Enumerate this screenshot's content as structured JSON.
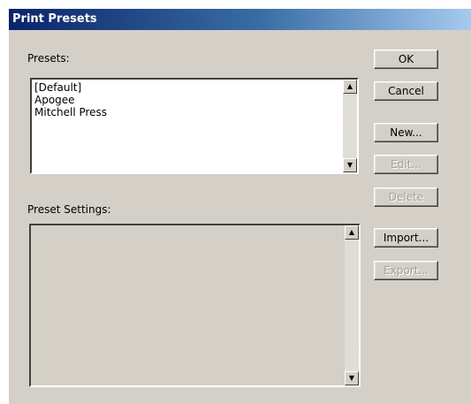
{
  "window": {
    "title": "Print Presets"
  },
  "presets": {
    "label": "Presets:",
    "items": [
      "[Default]",
      "Apogee",
      "Mitchell Press"
    ]
  },
  "preset_settings": {
    "label": "Preset Settings:"
  },
  "scrollbar": {
    "up_glyph": "▲",
    "down_glyph": "▼"
  },
  "buttons": {
    "ok": "OK",
    "cancel": "Cancel",
    "new": "New...",
    "edit": "Edit...",
    "delete": "Delete",
    "import": "Import...",
    "export": "Export..."
  },
  "colors": {
    "title_gradient_start": "#0a246a",
    "title_gradient_end": "#a6caf0",
    "dialog_background": "#d4d0c8",
    "disabled_text": "#a0a0a0"
  }
}
